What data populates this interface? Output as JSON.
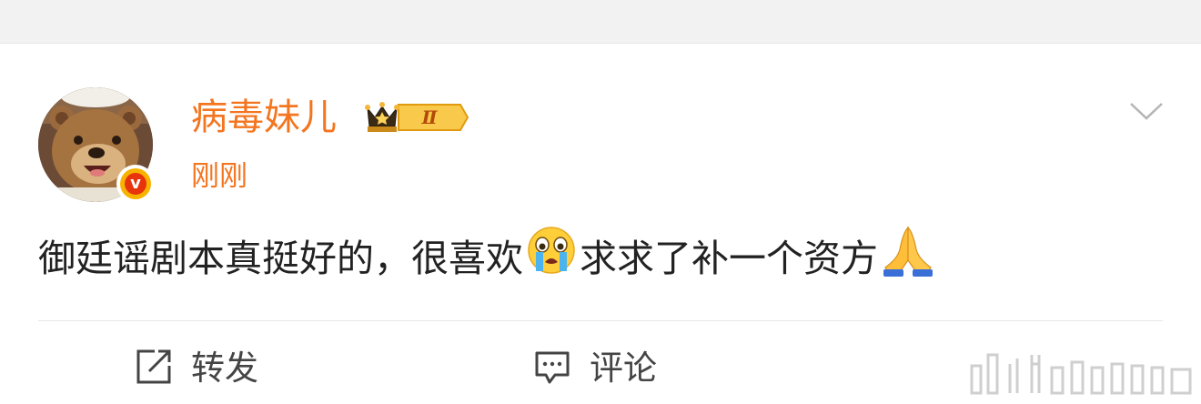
{
  "post": {
    "author": {
      "name": "病毒妹儿",
      "verified": true,
      "badge_level": "Ⅱ"
    },
    "timestamp": "刚刚",
    "content": {
      "text_before": "御廷谣剧本真挺好的，很喜欢",
      "emoji_1": "crying-face",
      "text_middle": "求求了补一个资方",
      "emoji_2": "praying-hands"
    }
  },
  "actions": {
    "repost_label": "转发",
    "comment_label": "评论"
  },
  "colors": {
    "accent": "#f4751f",
    "text": "#222222",
    "icon": "#444444",
    "divider": "#e8e8e8"
  }
}
